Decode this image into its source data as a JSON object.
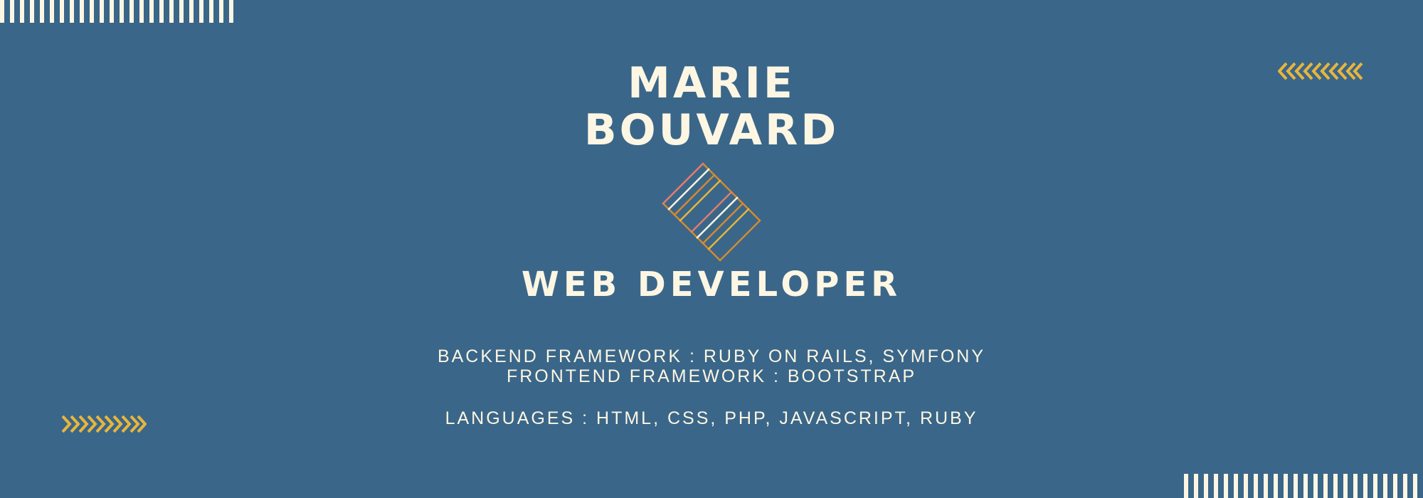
{
  "profile": {
    "first_name": "MARIE",
    "last_name": "BOUVARD",
    "role": "WEB DEVELOPER"
  },
  "skills": {
    "backend": "BACKEND FRAMEWORK : RUBY ON RAILS, SYMFONY",
    "frontend": "FRONTEND FRAMEWORK : BOOTSTRAP",
    "languages": "LANGUAGES : HTML, CSS, PHP, JAVASCRIPT, RUBY"
  },
  "colors": {
    "background": "#3a6689",
    "text": "#fdf6e3",
    "accent_yellow": "#e8b53c",
    "accent_orange": "#d48a2e",
    "accent_pink": "#e07c72"
  },
  "icons": {
    "top_left_stripes": "vertical-stripes-decoration",
    "bottom_right_stripes": "vertical-stripes-decoration",
    "top_right_chevrons": "chevrons-left-icon",
    "bottom_left_chevrons": "chevrons-right-icon",
    "center_emblem": "striped-diamond-emblem"
  }
}
